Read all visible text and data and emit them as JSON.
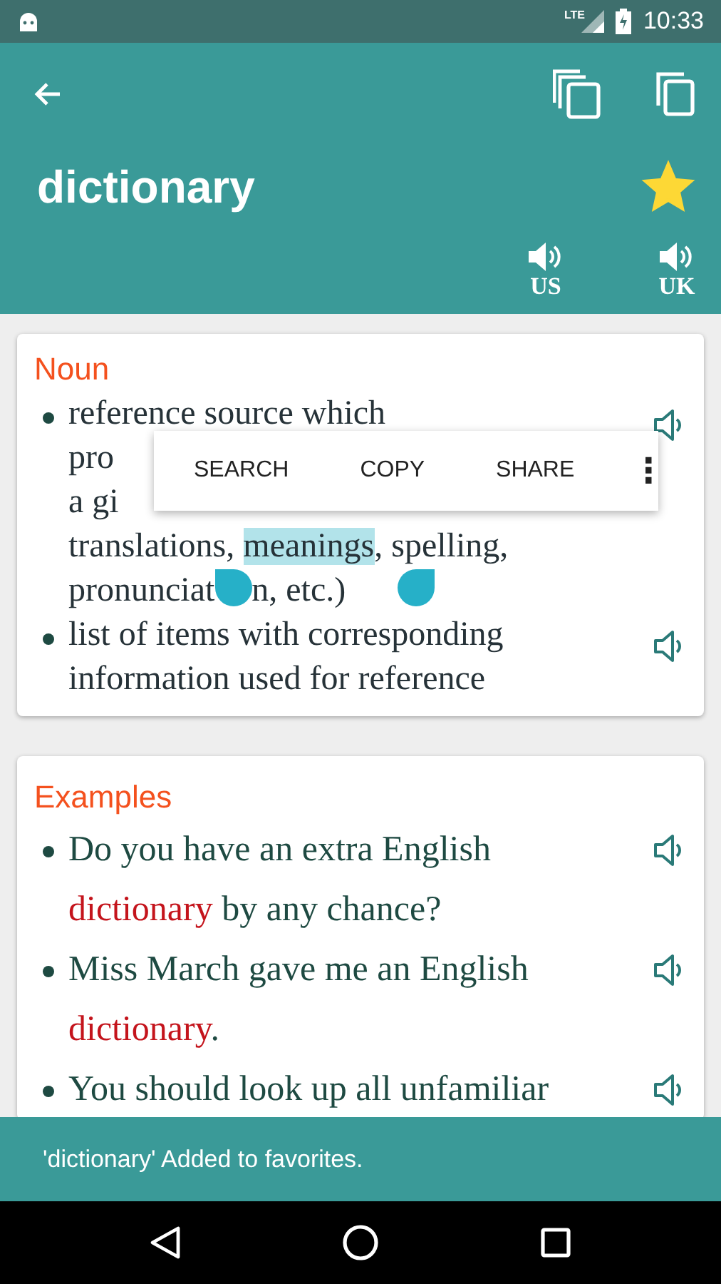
{
  "status_bar": {
    "network": "LTE",
    "time": "10:33"
  },
  "app_bar": {
    "word": "dictionary",
    "favorite": true,
    "pronunciations": [
      {
        "label": "US"
      },
      {
        "label": "UK"
      }
    ]
  },
  "meanings": {
    "heading": "Noun",
    "definitions": [
      {
        "lines": [
          [
            {
              "text": "reference source which"
            }
          ],
          [
            {
              "text": "pro"
            }
          ],
          [
            {
              "text": "a gi"
            }
          ],
          [
            {
              "text": "translations, "
            },
            {
              "text": "meanings",
              "selected": true
            },
            {
              "text": ", spelling,"
            }
          ],
          [
            {
              "text": "pronunciat"
            },
            {
              "kind": "handle",
              "end": false
            },
            {
              "text": "n, etc.)"
            },
            {
              "kind": "handle",
              "end": true
            }
          ]
        ]
      },
      {
        "lines": [
          [
            {
              "text": "list of items with corresponding"
            }
          ],
          [
            {
              "text": "information used for reference"
            }
          ]
        ]
      }
    ]
  },
  "selection_menu": {
    "items": [
      "SEARCH",
      "COPY",
      "SHARE"
    ],
    "more": "⋮"
  },
  "examples": {
    "heading": "Examples",
    "items": [
      {
        "lines": [
          [
            {
              "text": "Do you have an extra English"
            }
          ],
          [
            {
              "text": "dictionary",
              "emphasis": true
            },
            {
              "text": " by any chance?"
            }
          ]
        ]
      },
      {
        "lines": [
          [
            {
              "text": "Miss March gave me an English"
            }
          ],
          [
            {
              "text": "dictionary",
              "emphasis": true
            },
            {
              "text": "."
            }
          ]
        ]
      },
      {
        "lines": [
          [
            {
              "text": "You should look up all unfamiliar"
            }
          ]
        ]
      }
    ]
  },
  "snackbar": {
    "message": "'dictionary' Added to favorites."
  }
}
